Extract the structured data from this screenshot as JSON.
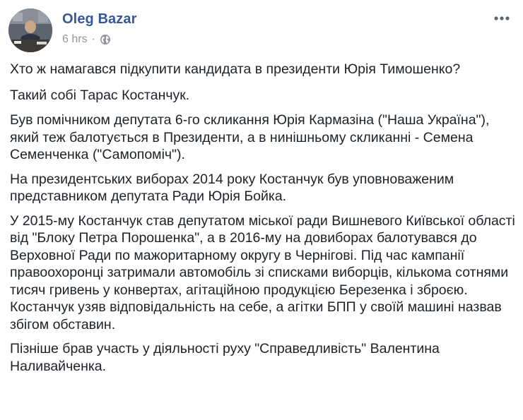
{
  "post": {
    "author": "Oleg Bazar",
    "time": "6 hrs",
    "separator": "·",
    "privacy_icon": "globe-icon",
    "more_icon": "more-options-icon",
    "paragraphs": [
      "Хто ж намагався підкупити кандидата в президенти Юрія Тимошенко?",
      "Такий собі Тарас Костанчук.",
      "Був помічником депутата 6-го скликання Юрія Кармазіна (\"Наша Україна\"), який теж балотується в Президенти, а в нинішньому скликанні - Семена Семенченка (\"Самопоміч\").",
      "На президентських виборах 2014 року Костанчук був уповноваженим представником депутата Ради Юрія Бойка.",
      "У 2015-му Костанчук став депутатом міської ради Вишневого Київської області від \"Блоку Петра Порошенка\", а в 2016-му на довиборах балотувався до Верховної Ради по мажоритарному округу в Чернігові. Під час кампанії правоохоронці затримали автомобіль зі списками виборців, кількома сотнями тисяч гривень у конвертах, агітаційною продукцією Березенка і зброєю. Костанчук узяв відповідальність на себе, а агітки БПП у своїй машині назвав збігом обставин.",
      "Пізніше брав участь у діяльності руху \"Справедливість\" Валентина Наливайченка."
    ]
  },
  "colors": {
    "author": "#365899",
    "meta": "#90949c",
    "text": "#1d2129"
  }
}
